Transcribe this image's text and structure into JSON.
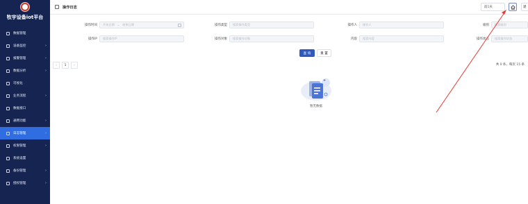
{
  "app": {
    "title": "牧宇设备iot平台"
  },
  "sidebar": {
    "items": [
      {
        "label": "数据管理",
        "arrow": ""
      },
      {
        "label": "设备监控",
        "arrow": "›"
      },
      {
        "label": "报警管理",
        "arrow": "›"
      },
      {
        "label": "数据分析",
        "arrow": "›"
      },
      {
        "label": "可视化",
        "arrow": ""
      },
      {
        "label": "业务流程",
        "arrow": "›"
      },
      {
        "label": "数据接口",
        "arrow": ""
      },
      {
        "label": "通用功能",
        "arrow": "›"
      },
      {
        "label": "日志管理",
        "arrow": "›"
      },
      {
        "label": "权限管理",
        "arrow": "›"
      },
      {
        "label": "系统设置",
        "arrow": ""
      },
      {
        "label": "备份管理",
        "arrow": "›"
      },
      {
        "label": "授权管理",
        "arrow": "›"
      }
    ],
    "active_index": 8
  },
  "header": {
    "title": "操作日志",
    "days_select": "前1天",
    "exit_label": "退"
  },
  "filters": {
    "time": {
      "label": "操作时间",
      "start_placeholder": "开始日期",
      "sep": "~",
      "end_placeholder": "结束日期"
    },
    "type": {
      "label": "操作类型",
      "placeholder": "搜索操作类型"
    },
    "operator": {
      "label": "操作人",
      "placeholder": "操作人"
    },
    "level": {
      "label": "级别",
      "placeholder": "搜索级别"
    },
    "ip": {
      "label": "操作IP",
      "placeholder": "搜索操作IP"
    },
    "object": {
      "label": "操作对象",
      "placeholder": "搜索操作对象"
    },
    "content": {
      "label": "内容",
      "placeholder": "搜索内容"
    },
    "status": {
      "label": "操作状态",
      "placeholder": "搜索操作状态"
    }
  },
  "actions": {
    "query_label": "查 询",
    "reset_label": "重 置"
  },
  "pagination": {
    "prev": "‹",
    "page": "1",
    "next": "›",
    "total_text": "共 0 条，每页 15 条"
  },
  "empty_state": {
    "text": "暂无数据"
  },
  "colors": {
    "sidebar_bg": "#162452",
    "active": "#2f6de0",
    "primary": "#2e5ac0",
    "annotation": "#e53935"
  }
}
